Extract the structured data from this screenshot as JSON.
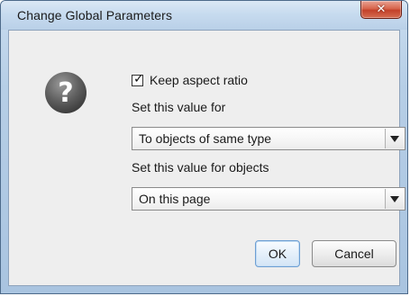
{
  "window": {
    "title": "Change Global Parameters",
    "close_symbol": "✕"
  },
  "dialog": {
    "icon": "question-icon",
    "keep_aspect_ratio": {
      "label": "Keep aspect ratio",
      "checked": true
    },
    "set_value_for": {
      "label": "Set this value for",
      "selected": "To objects of same type"
    },
    "set_value_for_objects": {
      "label": "Set this value for objects",
      "selected": "On this page"
    }
  },
  "buttons": {
    "ok": "OK",
    "cancel": "Cancel"
  },
  "colors": {
    "titlebar": "#c7dbef",
    "close_button": "#c3422a",
    "client_background": "#eeeeee",
    "default_button_border": "#6d9fd3"
  }
}
